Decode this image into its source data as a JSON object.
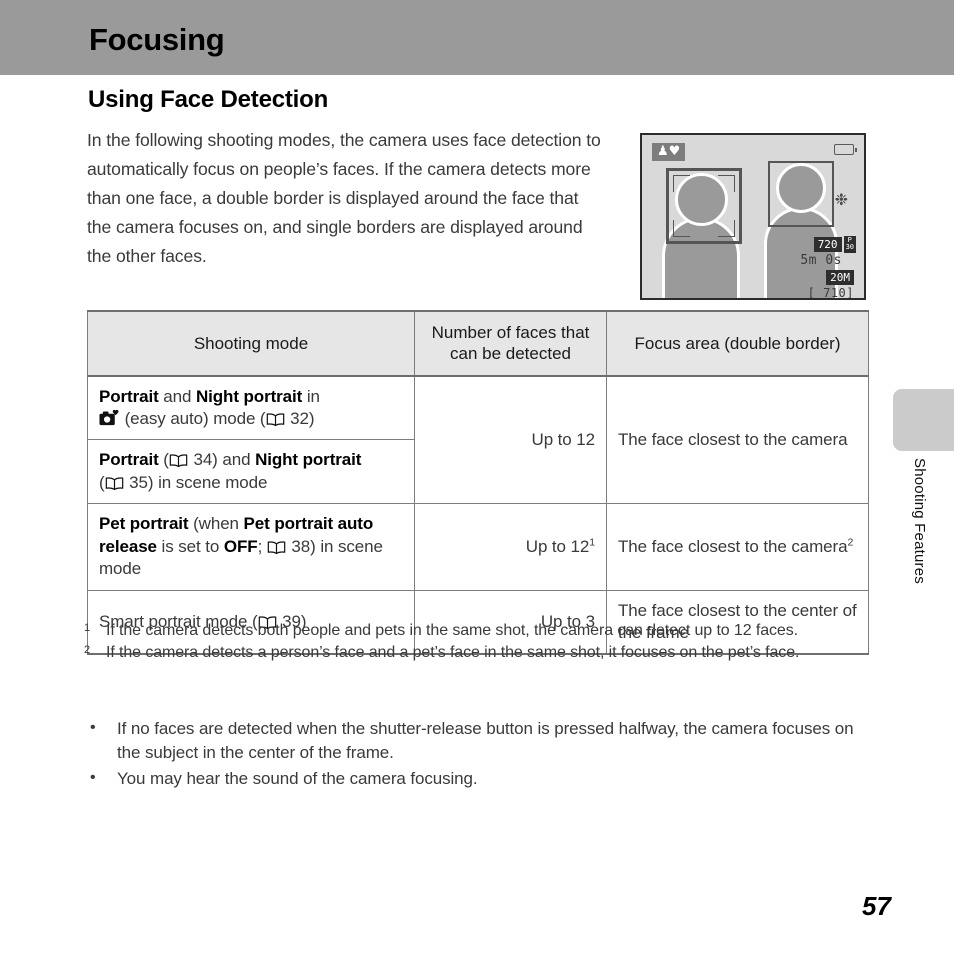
{
  "header": {
    "title": "Focusing"
  },
  "section": {
    "heading": "Using Face Detection",
    "intro": "In the following shooting modes, the camera uses face detection to automatically focus on people’s faces. If the camera detects more than one face, a double border is displayed around the face that the camera focuses on, and single borders are displayed around the other faces."
  },
  "figure": {
    "name": "camera-monitor-face-detection",
    "mode_badge": "♟♥",
    "movie_quality": "720",
    "movie_fps_top": "P",
    "movie_fps_bottom": "30",
    "record_time": "5m 0s",
    "image_size": "20M",
    "shots_remaining": "[ 710]"
  },
  "table": {
    "headers": [
      "Shooting mode",
      "Number of faces that can be detected",
      "Focus area (double border)"
    ],
    "rows": [
      {
        "mode_parts": [
          {
            "text": "Portrait",
            "bold": true
          },
          {
            "text": " and ",
            "bold": false
          },
          {
            "text": "Night portrait",
            "bold": true
          },
          {
            "text": " in",
            "bold": false
          },
          {
            "text": "\n",
            "bold": false
          },
          {
            "text": "EASY-AUTO-ICON",
            "bold": false
          },
          {
            "text": " (easy auto) mode (",
            "bold": false
          },
          {
            "text": "BOOK-ICON",
            "bold": false
          },
          {
            "text": " 32)",
            "bold": false
          }
        ],
        "count": "Up to 12",
        "count_sup": "",
        "focus": "The face closest to the camera",
        "focus_sup": ""
      },
      {
        "mode_parts": [
          {
            "text": "Portrait",
            "bold": true
          },
          {
            "text": " (",
            "bold": false
          },
          {
            "text": "BOOK-ICON",
            "bold": false
          },
          {
            "text": " 34) and ",
            "bold": false
          },
          {
            "text": "Night portrait",
            "bold": true
          },
          {
            "text": "\n",
            "bold": false
          },
          {
            "text": "(",
            "bold": false
          },
          {
            "text": "BOOK-ICON",
            "bold": false
          },
          {
            "text": " 35) in scene mode",
            "bold": false
          }
        ],
        "count": "",
        "count_sup": "",
        "focus": "",
        "focus_sup": ""
      },
      {
        "mode_parts": [
          {
            "text": "Pet portrait",
            "bold": true
          },
          {
            "text": " (when ",
            "bold": false
          },
          {
            "text": "Pet portrait auto",
            "bold": true
          },
          {
            "text": "\n",
            "bold": false
          },
          {
            "text": "release",
            "bold": true
          },
          {
            "text": " is set to ",
            "bold": false
          },
          {
            "text": "OFF",
            "bold": true
          },
          {
            "text": "; ",
            "bold": false
          },
          {
            "text": "BOOK-ICON",
            "bold": false
          },
          {
            "text": " 38) in scene",
            "bold": false
          },
          {
            "text": "\n",
            "bold": false
          },
          {
            "text": "mode",
            "bold": false
          }
        ],
        "count": "Up to 12",
        "count_sup": "1",
        "focus": "The face closest to the camera",
        "focus_sup": "2"
      },
      {
        "mode_parts": [
          {
            "text": "Smart portrait mode (",
            "bold": false
          },
          {
            "text": "BOOK-ICON",
            "bold": false
          },
          {
            "text": " 39)",
            "bold": false
          }
        ],
        "count": "Up to 3",
        "count_sup": "",
        "focus": "The face closest to the center of the frame",
        "focus_sup": ""
      }
    ]
  },
  "footnotes": [
    {
      "marker": "1",
      "text": "If the camera detects both people and pets in the same shot, the camera can detect up to 12 faces."
    },
    {
      "marker": "2",
      "text": "If the camera detects a person’s face and a pet’s face in the same shot, it focuses on the pet’s face."
    }
  ],
  "bullets": [
    {
      "marker": "•",
      "text": "If no faces are detected when the shutter-release button is pressed halfway, the camera focuses on the subject in the center of the frame."
    },
    {
      "marker": "•",
      "text": "You may hear the sound of the camera focusing."
    }
  ],
  "side_tab": {
    "label": "Shooting Features"
  },
  "page_number": "57",
  "colors": {
    "header_band": "#9a9a9a",
    "table_header_bg": "#e6e6e6",
    "table_border": "#7d7d7d",
    "side_tab": "#cbcbcb",
    "lcd_bg": "#d9d9d9"
  }
}
